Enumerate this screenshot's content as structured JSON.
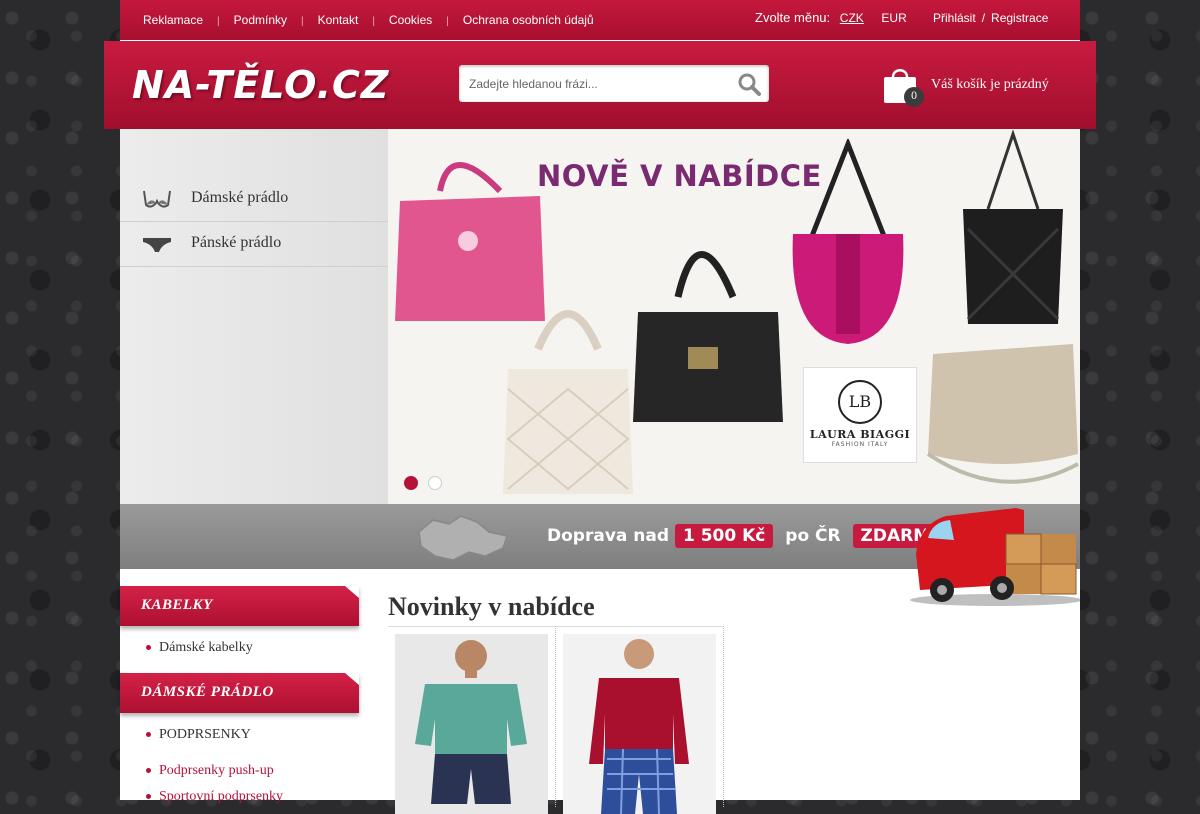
{
  "topbar": {
    "links": [
      "Reklamace",
      "Podmínky",
      "Kontakt",
      "Cookies",
      "Ochrana osobních údajů"
    ],
    "currency_label": "Zvolte měnu:",
    "currencies": [
      "CZK",
      "EUR"
    ],
    "login": "Přihlásit",
    "register": "Registrace"
  },
  "header": {
    "logo": "NA-TĚLO.CZ",
    "search_placeholder": "Zadejte hledanou frázi...",
    "cart_count": "0",
    "cart_text": "Váš košík je prázdný"
  },
  "category_menu": [
    "Dámské prádlo",
    "Pánské prádlo"
  ],
  "banner": {
    "title": "NOVĚ V NABÍDCE",
    "brand_monogram": "LB",
    "brand_name": "LAURA BIAGGI",
    "brand_sub": "FASHION ITALY",
    "active_slide": 1,
    "slides": 2
  },
  "shipping": {
    "prefix": "Doprava nad",
    "amount": "1 500 Kč",
    "middle": "po ČR",
    "badge": "ZDARMA"
  },
  "sidebar": {
    "sections": [
      {
        "title": "KABELKY",
        "items": [
          "Dámské kabelky"
        ]
      },
      {
        "title": "DÁMSKÉ PRÁDLO",
        "items": [
          "PODPRSENKY",
          "Podprsenky push-up",
          "Sportovní podprsenky"
        ]
      }
    ]
  },
  "main": {
    "title": "Novinky v nabídce"
  },
  "colors": {
    "brand_red": "#b5123a",
    "banner_title": "#7a2a70"
  }
}
